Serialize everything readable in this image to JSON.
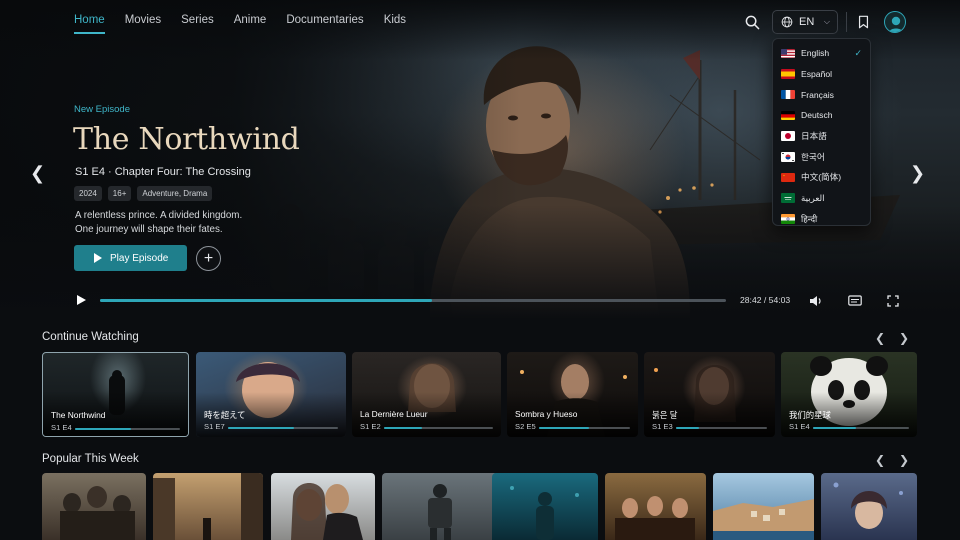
{
  "nav": {
    "links": [
      {
        "label": "Home",
        "active": true
      },
      {
        "label": "Movies"
      },
      {
        "label": "Series"
      },
      {
        "label": "Anime"
      },
      {
        "label": "Documentaries"
      },
      {
        "label": "Kids"
      }
    ],
    "icons": {
      "search": "search-icon",
      "globe": "globe-icon",
      "bookmark": "bookmark-icon",
      "profile": "avatar"
    }
  },
  "language": {
    "current": "EN",
    "options": [
      {
        "label": "English",
        "flag": "us",
        "selected": true
      },
      {
        "label": "Español",
        "flag": "es"
      },
      {
        "label": "Français",
        "flag": "fr"
      },
      {
        "label": "Deutsch",
        "flag": "de"
      },
      {
        "label": "日本語",
        "flag": "jp"
      },
      {
        "label": "한국어",
        "flag": "kr"
      },
      {
        "label": "中文(简体)",
        "flag": "cn"
      },
      {
        "label": "العربية",
        "flag": "sa"
      },
      {
        "label": "हिन्दी",
        "flag": "in"
      }
    ]
  },
  "hero": {
    "eyebrow": "New Episode",
    "title": "The Northwind",
    "subtitle": "S1 E4 · Chapter Four: The Crossing",
    "tags": [
      "2024",
      "16+",
      "Adventure, Drama"
    ],
    "description_line1": "A relentless prince. A divided kingdom.",
    "description_line2": "One journey will shape their fates.",
    "play_label": "Play Episode",
    "add_label": "+"
  },
  "player": {
    "elapsed": "28:42",
    "duration": "54:03",
    "time_display": "28:42 / 54:03",
    "progress_fraction": 0.531
  },
  "continue_watching": {
    "title": "Continue Watching",
    "items": [
      {
        "title": "The Northwind",
        "episode": "S1 E4",
        "progress": 0.53
      },
      {
        "title": "時を超えて",
        "episode": "S1 E7",
        "progress": 0.6
      },
      {
        "title": "La Dernière Lueur",
        "episode": "S1 E2",
        "progress": 0.35
      },
      {
        "title": "Sombra y Hueso",
        "episode": "S2 E5",
        "progress": 0.55
      },
      {
        "title": "붉은 달",
        "episode": "S1 E3",
        "progress": 0.25
      },
      {
        "title": "我们的星球",
        "episode": "S1 E4",
        "progress": 0.45
      }
    ]
  },
  "popular": {
    "title": "Popular This Week"
  },
  "colors": {
    "accent": "#2ea6b8",
    "accent_text": "#3fb6c9",
    "title_gold": "#e9d8bd",
    "background": "#0b0d10"
  }
}
